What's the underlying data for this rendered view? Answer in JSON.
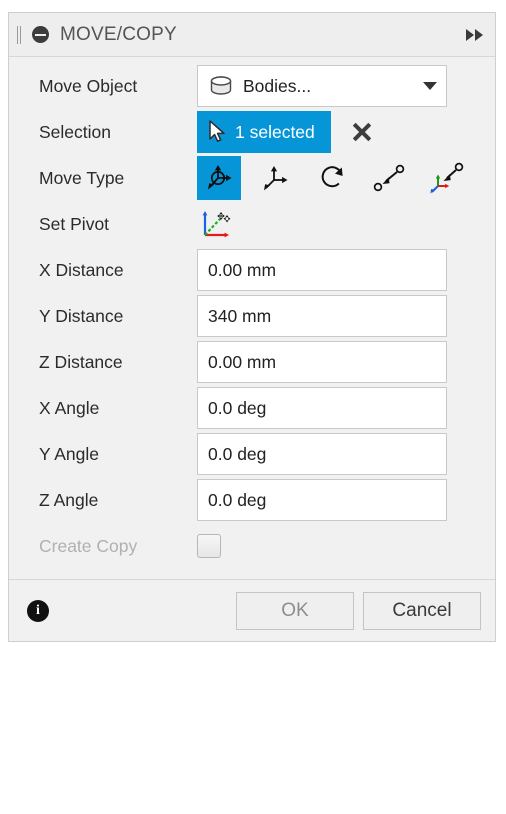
{
  "dialog": {
    "title": "MOVE/COPY",
    "grip_name": "drag-handle",
    "collapse_icon": "minus-circle-icon",
    "expand_icon": "double-chevron-right-icon"
  },
  "fields": {
    "move_object": {
      "label": "Move Object",
      "value": "Bodies...",
      "icon": "body-cylinder-icon",
      "caret": "chevron-down-icon"
    },
    "selection": {
      "label": "Selection",
      "value": "1 selected",
      "cursor_icon": "cursor-arrow-icon",
      "clear_icon": "close-x-icon",
      "accent_color": "#0696d7"
    },
    "move_type": {
      "label": "Move Type",
      "selected_index": 0,
      "options": [
        {
          "name": "free-move-icon",
          "title": "Free Move"
        },
        {
          "name": "translate-axes-icon",
          "title": "Translate"
        },
        {
          "name": "rotate-icon",
          "title": "Rotate"
        },
        {
          "name": "point-to-point-icon",
          "title": "Point to Point"
        },
        {
          "name": "point-to-position-icon",
          "title": "Point to Position"
        }
      ]
    },
    "set_pivot": {
      "label": "Set Pivot",
      "icon": "set-pivot-axes-icon"
    },
    "x_distance": {
      "label": "X Distance",
      "value": "0.00 mm"
    },
    "y_distance": {
      "label": "Y Distance",
      "value": "340 mm"
    },
    "z_distance": {
      "label": "Z Distance",
      "value": "0.00 mm"
    },
    "x_angle": {
      "label": "X Angle",
      "value": "0.0 deg"
    },
    "y_angle": {
      "label": "Y Angle",
      "value": "0.0 deg"
    },
    "z_angle": {
      "label": "Z Angle",
      "value": "0.0 deg"
    },
    "create_copy": {
      "label": "Create Copy",
      "checked": false,
      "disabled": true
    }
  },
  "footer": {
    "info_icon": "info-icon",
    "info_glyph": "i",
    "ok_label": "OK",
    "cancel_label": "Cancel"
  }
}
